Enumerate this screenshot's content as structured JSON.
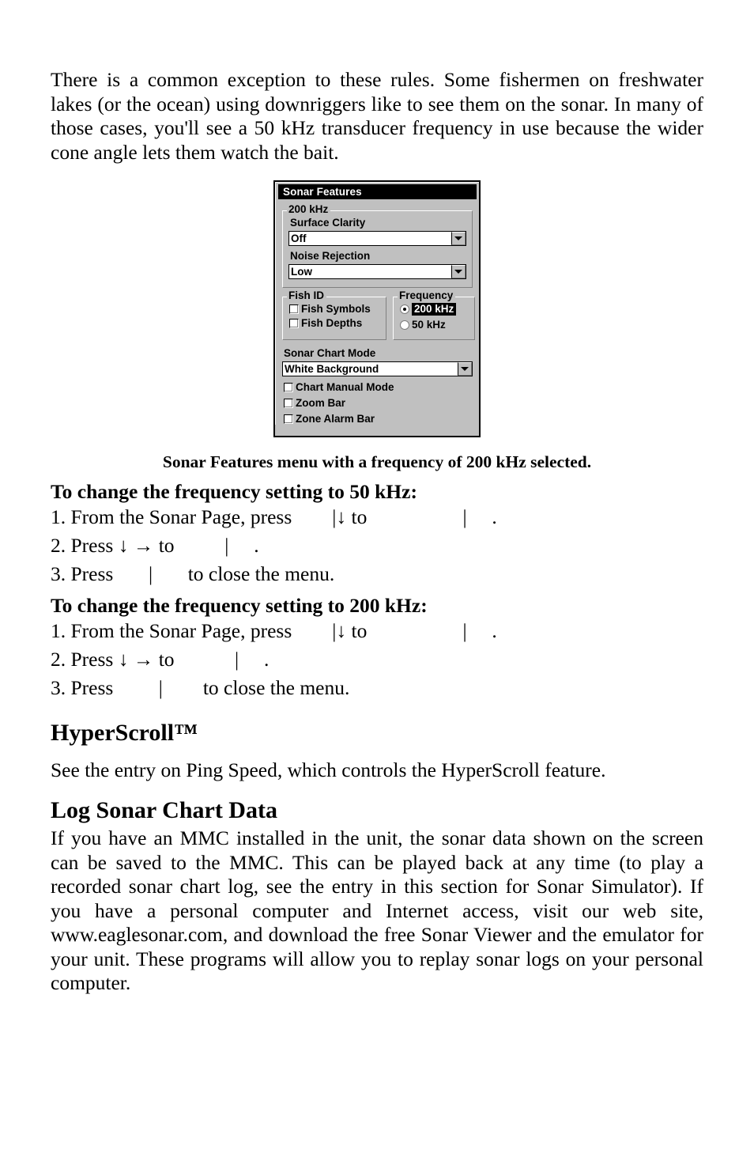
{
  "document": {
    "intro_paragraph": "There is a common exception to these rules. Some fishermen on freshwater lakes (or the ocean) using downriggers like to see them on the sonar. In many of those cases, you'll see a 50 kHz transducer frequency in use because the wider cone angle lets them watch the bait.",
    "figure_caption": "Sonar Features menu with a frequency of 200 kHz selected."
  },
  "dialog": {
    "title": "Sonar Features",
    "group_200khz": {
      "label": "200 kHz",
      "surface_clarity_label": "Surface Clarity",
      "surface_clarity_value": "Off",
      "noise_rejection_label": "Noise Rejection",
      "noise_rejection_value": "Low"
    },
    "fish_id": {
      "label": "Fish ID",
      "items": [
        {
          "label": "Fish Symbols",
          "checked": false
        },
        {
          "label": "Fish Depths",
          "checked": false
        }
      ]
    },
    "frequency": {
      "label": "Frequency",
      "options": [
        {
          "label": "200 kHz",
          "selected": true
        },
        {
          "label": "50 kHz",
          "selected": false
        }
      ]
    },
    "sonar_chart_mode": {
      "label": "Sonar Chart Mode",
      "value": "White Background"
    },
    "bottom_checks": [
      {
        "label": "Chart Manual Mode",
        "checked": false
      },
      {
        "label": "Zoom Bar",
        "checked": false
      },
      {
        "label": "Zone Alarm Bar",
        "checked": false
      }
    ],
    "icons": {
      "dropdown": "chevron-down-icon",
      "radio_selected": "radio-selected-icon",
      "radio_unselected": "radio-unselected-icon",
      "checkbox_unchecked": "checkbox-unchecked-icon"
    }
  },
  "procedures": [
    {
      "heading": "To change the frequency setting to 50 kHz:",
      "steps": [
        "1. From the Sonar Page, press        |↓ to                   |     .",
        "2. Press ↓ → to          |     .",
        "3. Press       |       to close the menu."
      ]
    },
    {
      "heading": "To change the frequency setting to 200 kHz:",
      "steps": [
        "1. From the Sonar Page, press        |↓ to                   |     .",
        "2. Press ↓ → to            |     .",
        "3. Press         |        to close the menu."
      ]
    }
  ],
  "sections": [
    {
      "heading": "HyperScroll™",
      "body": "See the entry on Ping Speed, which controls the HyperScroll feature."
    },
    {
      "heading": "Log Sonar Chart Data",
      "body": "If you have an MMC installed in the unit, the sonar data shown on the screen can be saved to the MMC. This can be played back at any time (to play a recorded sonar chart log, see the entry in this section for Sonar Simulator). If you have a personal computer and Internet access, visit our web site, www.eaglesonar.com, and download the free Sonar Viewer and the emulator for your unit. These programs will allow you to replay sonar logs on your personal computer."
    }
  ],
  "colors": {
    "dialog_face": "#c0c0c0",
    "titlebar_bg": "#000000",
    "titlebar_fg": "#ffffff",
    "field_bg": "#ffffff",
    "highlight_bg": "#000000",
    "highlight_fg": "#ffffff"
  }
}
